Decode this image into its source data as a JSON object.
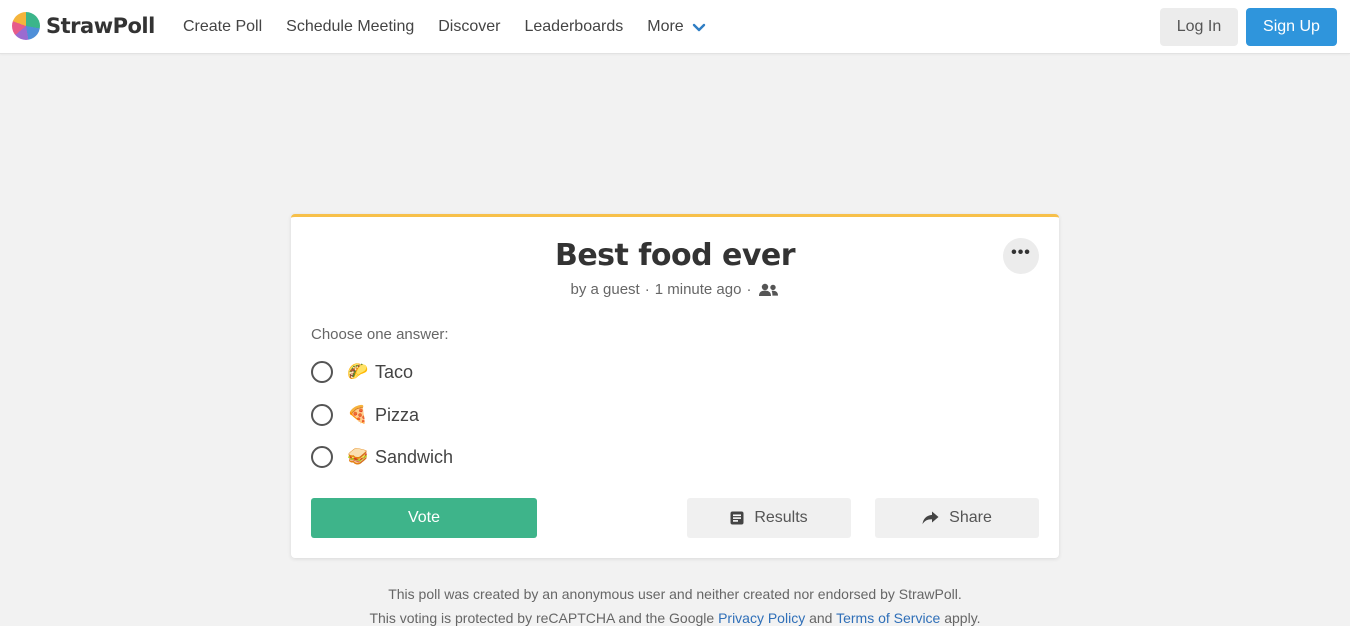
{
  "header": {
    "logo_text": "StrawPoll",
    "nav": [
      {
        "label": "Create Poll"
      },
      {
        "label": "Schedule Meeting"
      },
      {
        "label": "Discover"
      },
      {
        "label": "Leaderboards"
      },
      {
        "label": "More"
      }
    ],
    "login_label": "Log In",
    "signup_label": "Sign Up"
  },
  "poll": {
    "title": "Best food ever",
    "author": "by a guest",
    "time": "1 minute ago",
    "meta_sep": "·",
    "more_label": "•••",
    "choose_label": "Choose one answer:",
    "options": [
      {
        "emoji": "🌮",
        "label": "Taco"
      },
      {
        "emoji": "🍕",
        "label": "Pizza"
      },
      {
        "emoji": "🥪",
        "label": "Sandwich"
      }
    ],
    "vote_label": "Vote",
    "results_label": "Results",
    "share_label": "Share"
  },
  "footer": {
    "line1": "This poll was created by an anonymous user and neither created nor endorsed by StrawPoll.",
    "line2_prefix": "This voting is protected by reCAPTCHA and the Google ",
    "privacy_link": "Privacy Policy",
    "and_text": " and ",
    "terms_link": "Terms of Service",
    "line2_suffix": " apply."
  },
  "colors": {
    "accent_blue": "#2f95dc",
    "vote_green": "#3eb48a",
    "card_top_border": "#f7c04a",
    "link_blue": "#2f6fb8"
  },
  "icons": {
    "more": "chevron-down-icon",
    "meta": "people-icon",
    "results": "results-icon",
    "share": "share-icon",
    "menu": "ellipsis-icon"
  }
}
